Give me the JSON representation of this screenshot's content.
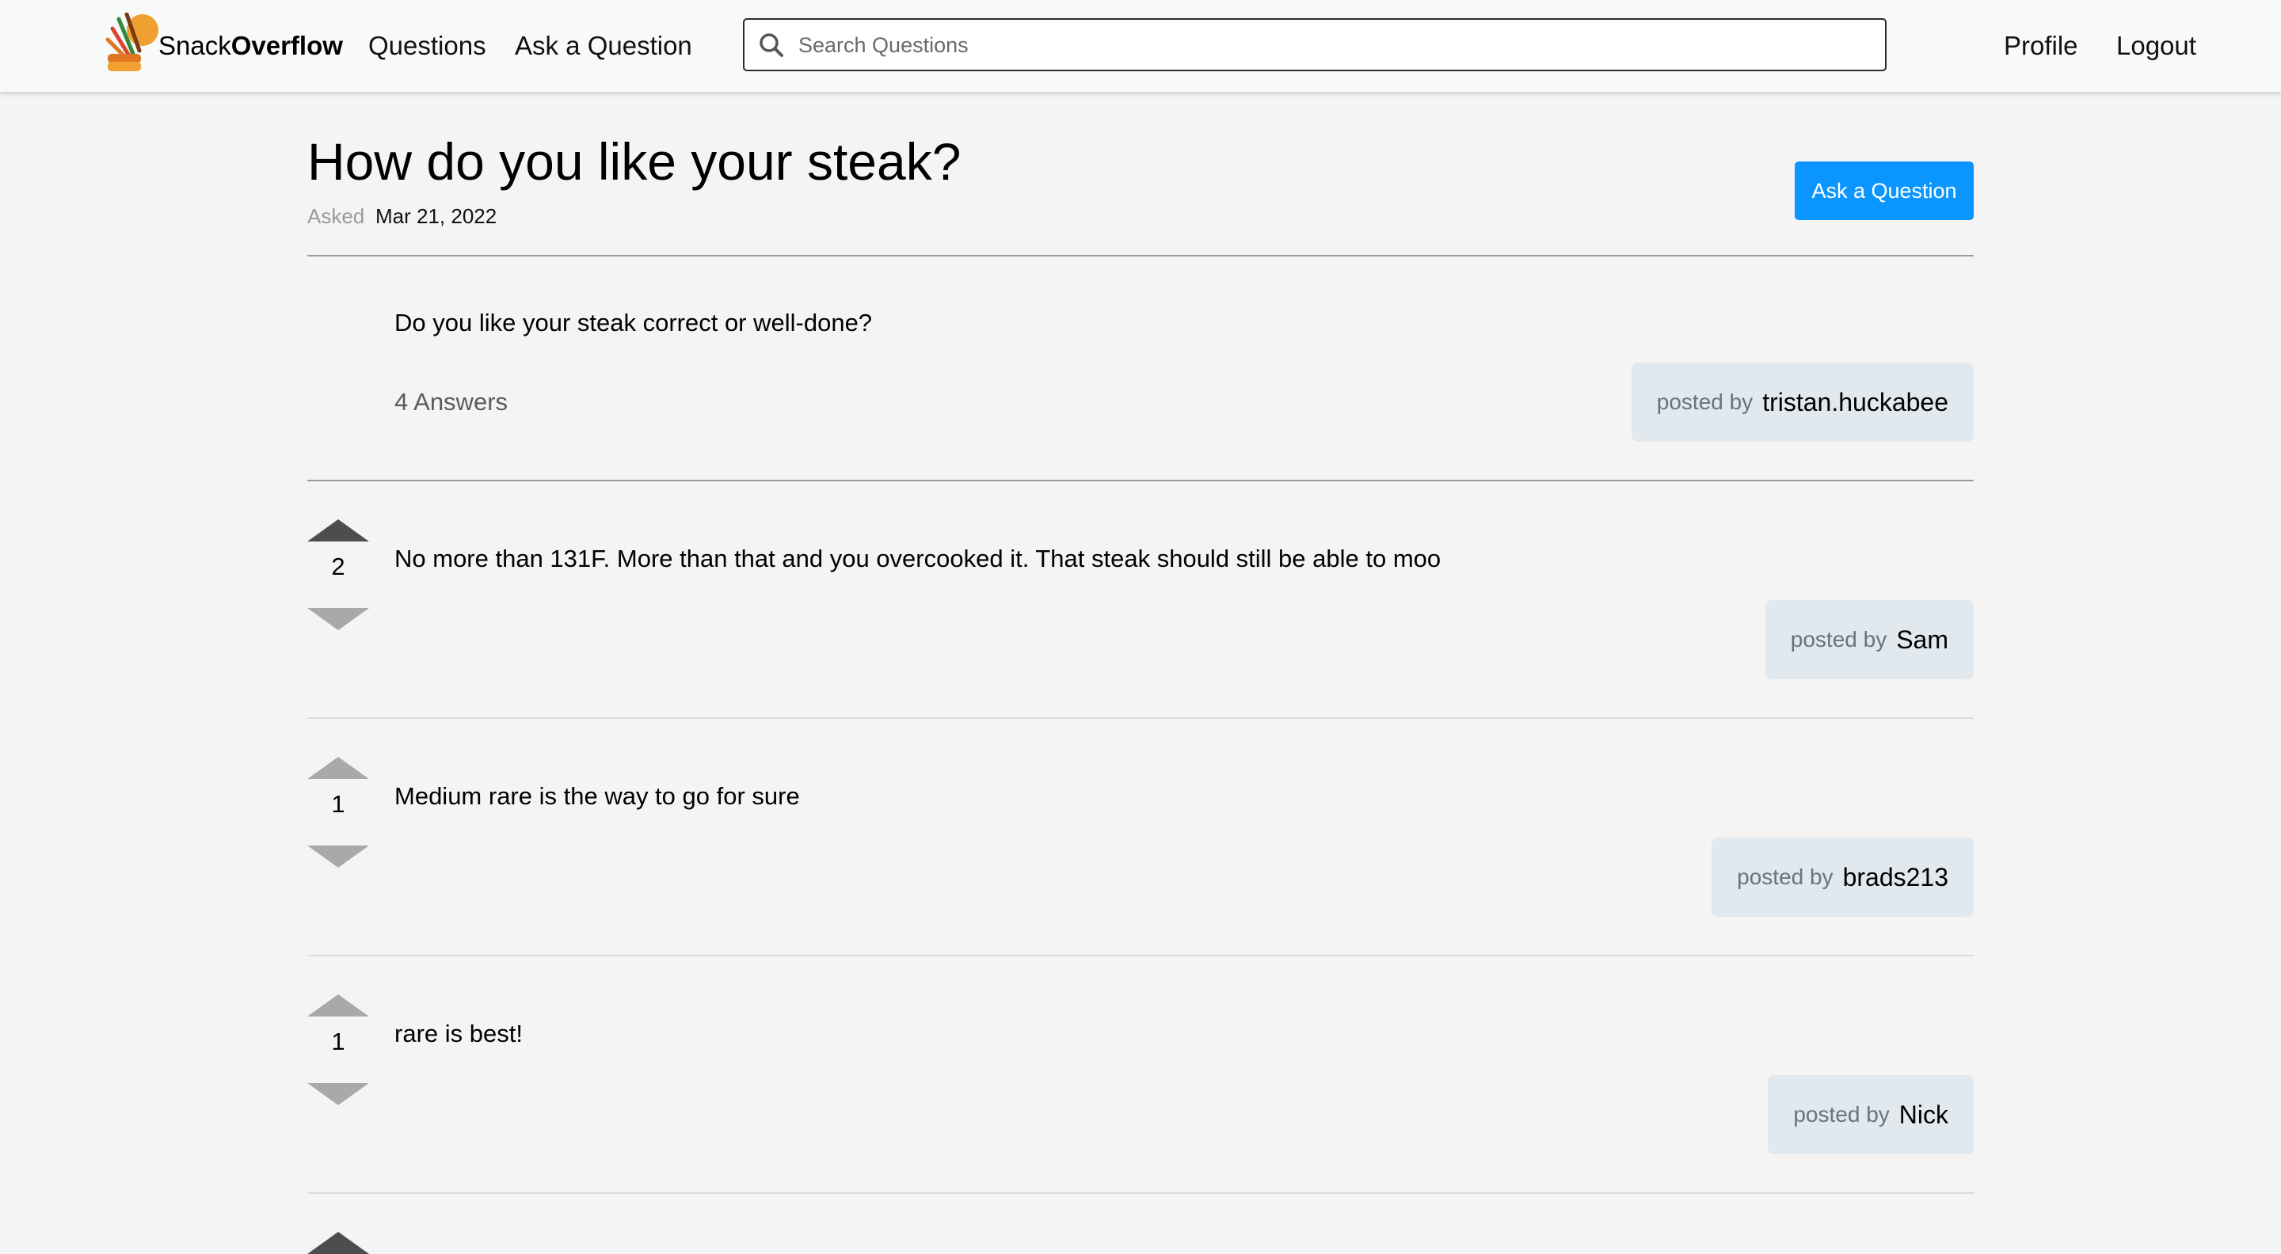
{
  "header": {
    "brand_light": "Snack",
    "brand_bold": "Overflow",
    "nav": [
      "Questions",
      "Ask a Question"
    ],
    "search_placeholder": "Search Questions",
    "profile": "Profile",
    "logout": "Logout"
  },
  "question": {
    "title": "How do you like your steak?",
    "asked_label": "Asked",
    "asked_date": "Mar 21, 2022",
    "ask_button": "Ask a Question",
    "body": "Do you like your steak correct or well-done?",
    "answers_count": "4 Answers",
    "posted_label": "posted by",
    "author": "tristan.huckabee"
  },
  "answers": [
    {
      "votes": "2",
      "body": "No more than 131F. More than that and you overcooked it. That steak should still be able to moo",
      "posted_label": "posted by",
      "author": "Sam",
      "upvoted": true
    },
    {
      "votes": "1",
      "body": "Medium rare is the way to go for sure",
      "posted_label": "posted by",
      "author": "brads213",
      "upvoted": false
    },
    {
      "votes": "1",
      "body": "rare is best!",
      "posted_label": "posted by",
      "author": "Nick",
      "upvoted": false
    }
  ],
  "colors": {
    "accent": "#0a95ff",
    "arrow_active": "#4d4d4d",
    "arrow_inactive": "#a9a9a9",
    "posted_bg": "#e1e9ef"
  }
}
